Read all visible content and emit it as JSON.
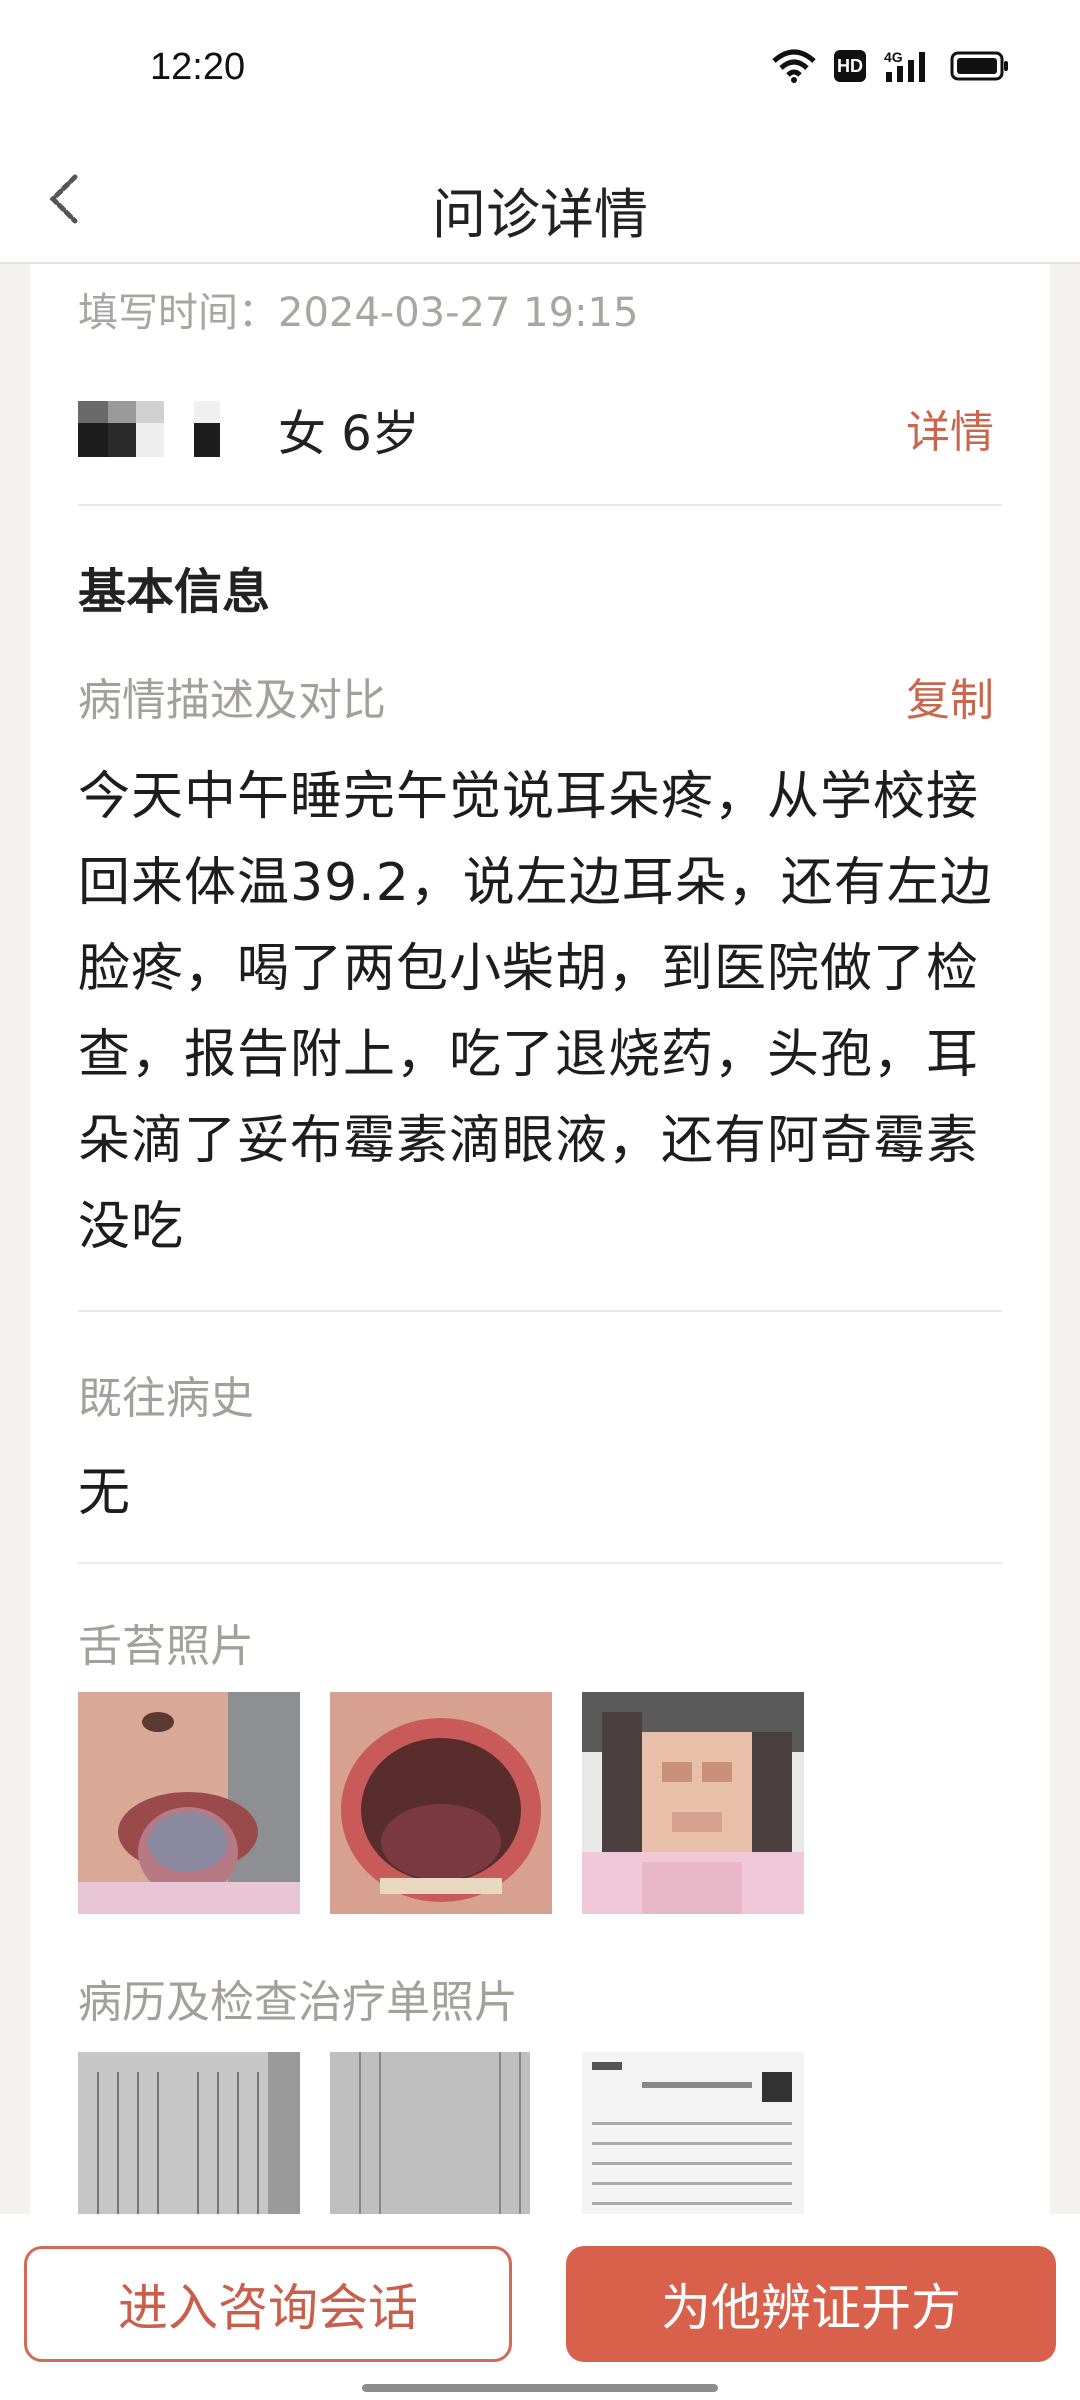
{
  "status_bar": {
    "time": "12:20",
    "hd_label": "HD",
    "network": "4G"
  },
  "nav": {
    "title": "问诊详情"
  },
  "record": {
    "fill_time": "填写时间：2024-03-27 19:15",
    "patient_info": "女 6岁",
    "detail_link": "详情",
    "section_title": "基本信息",
    "description_label": "病情描述及对比",
    "copy_label": "复制",
    "description": "今天中午睡完午觉说耳朵疼，从学校接回来体温39.2，说左边耳朵，还有左边脸疼，喝了两包小柴胡，到医院做了检查，报告附上，吃了退烧药，头孢，耳朵滴了妥布霉素滴眼液，还有阿奇霉素没吃",
    "history_label": "既往病史",
    "history_value": "无",
    "tongue_photos_label": "舌苔照片",
    "records_photos_label": "病历及检查治疗单照片"
  },
  "actions": {
    "enter_consult": "进入咨询会话",
    "prescribe": "为他辨证开方"
  },
  "colors": {
    "accent": "#d9604b",
    "link": "#c9664e"
  },
  "icons": {
    "back": "back-arrow-icon",
    "wifi": "wifi-icon",
    "signal": "signal-icon",
    "battery": "battery-icon"
  }
}
